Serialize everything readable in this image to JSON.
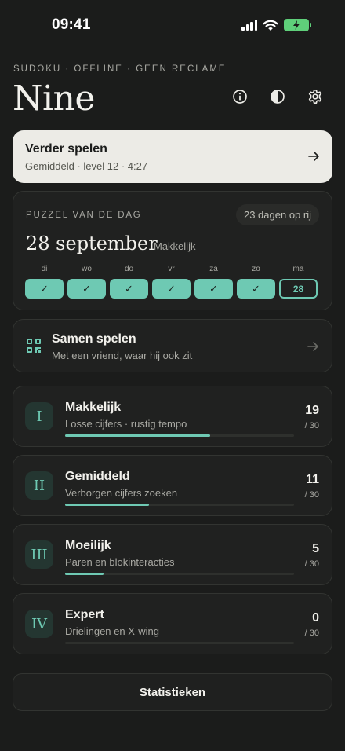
{
  "status": {
    "time": "09:41"
  },
  "header": {
    "eyebrow": "SUDOKU · OFFLINE · GEEN RECLAME",
    "title": "Nine",
    "icons": [
      "info-icon",
      "contrast-icon",
      "gear-icon"
    ]
  },
  "continue": {
    "title": "Verder spelen",
    "subtitle": "Gemiddeld · level 12 · 4:27"
  },
  "daily": {
    "label": "PUZZEL VAN DE DAG",
    "streak": "23 dagen op rij",
    "date": "28 september",
    "difficulty": "Makkelijk",
    "days": [
      {
        "name": "di",
        "mark": "✓",
        "done": true
      },
      {
        "name": "wo",
        "mark": "✓",
        "done": true
      },
      {
        "name": "do",
        "mark": "✓",
        "done": true
      },
      {
        "name": "vr",
        "mark": "✓",
        "done": true
      },
      {
        "name": "za",
        "mark": "✓",
        "done": true
      },
      {
        "name": "zo",
        "mark": "✓",
        "done": true
      },
      {
        "name": "ma",
        "mark": "28",
        "done": false
      }
    ]
  },
  "together": {
    "title": "Samen spelen",
    "subtitle": "Met een vriend, waar hij ook zit"
  },
  "levels": [
    {
      "roman": "I",
      "title": "Makkelijk",
      "subtitle": "Losse cijfers · rustig tempo",
      "count": "19",
      "total": "/ 30",
      "progress": 0.633
    },
    {
      "roman": "II",
      "title": "Gemiddeld",
      "subtitle": "Verborgen cijfers zoeken",
      "count": "11",
      "total": "/ 30",
      "progress": 0.367
    },
    {
      "roman": "III",
      "title": "Moeilijk",
      "subtitle": "Paren en blokinteracties",
      "count": "5",
      "total": "/ 30",
      "progress": 0.167
    },
    {
      "roman": "IV",
      "title": "Expert",
      "subtitle": "Drielingen en X-wing",
      "count": "0",
      "total": "/ 30",
      "progress": 0
    }
  ],
  "footer": {
    "stats_label": "Statistieken"
  },
  "colors": {
    "accent": "#6ec9b3",
    "background": "#1b1c1b",
    "card": "#202120",
    "continue_bg": "#ecebe6",
    "battery": "#5fcf7a"
  }
}
